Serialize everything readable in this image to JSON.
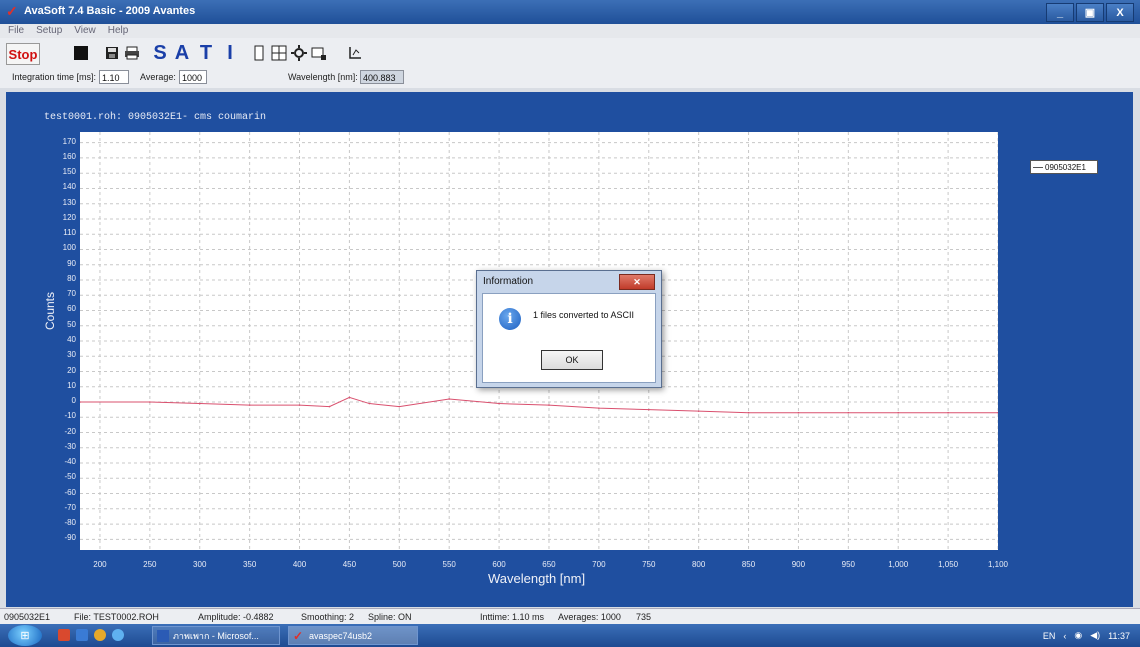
{
  "window": {
    "title": "AvaSoft 7.4 Basic - 2009 Avantes",
    "controls": [
      "_",
      "▣",
      "X"
    ]
  },
  "menu": [
    "File",
    "Setup",
    "View",
    "Help"
  ],
  "toolbar": {
    "stop_label": "Stop",
    "letters": [
      "S",
      "A",
      "T",
      "I"
    ]
  },
  "params": {
    "integration_label": "Integration time [ms]:",
    "integration_value": "1.10",
    "average_label": "Average:",
    "average_value": "1000",
    "wavelength_label": "Wavelength [nm]:",
    "wavelength_value": "400.883"
  },
  "chart_data": {
    "type": "line",
    "title": "test0001.roh: 0905032E1- cms coumarin",
    "xlabel": "Wavelength [nm]",
    "ylabel": "Counts",
    "xlim": [
      180,
      1100
    ],
    "ylim": [
      -97,
      177
    ],
    "x_ticks": [
      "200",
      "250",
      "300",
      "350",
      "400",
      "450",
      "500",
      "550",
      "600",
      "650",
      "700",
      "750",
      "800",
      "850",
      "900",
      "950",
      "1,000",
      "1,050",
      "1,100"
    ],
    "x_tick_values": [
      200,
      250,
      300,
      350,
      400,
      450,
      500,
      550,
      600,
      650,
      700,
      750,
      800,
      850,
      900,
      950,
      1000,
      1050,
      1100
    ],
    "y_ticks": [
      170,
      160,
      150,
      140,
      130,
      120,
      110,
      100,
      90,
      80,
      70,
      60,
      50,
      40,
      30,
      20,
      10,
      0,
      -10,
      -20,
      -30,
      -40,
      -50,
      -60,
      -70,
      -80,
      -90
    ],
    "grid": true,
    "legend": "right",
    "series": [
      {
        "name": "0905032E1",
        "color": "#d9506e",
        "x": [
          180,
          250,
          300,
          350,
          400,
          430,
          450,
          470,
          500,
          550,
          600,
          650,
          700,
          750,
          800,
          850,
          900,
          950,
          1000,
          1050,
          1100
        ],
        "y": [
          0,
          0,
          -1,
          -2,
          -2,
          -3,
          3,
          -1,
          -3,
          2,
          -1,
          -2,
          -4,
          -5,
          -6,
          -7,
          -7,
          -7,
          -7,
          -7,
          -7
        ]
      }
    ]
  },
  "dialog": {
    "title": "Information",
    "message": "1 files converted to ASCII",
    "ok_label": "OK"
  },
  "status": {
    "spectrum": "0905032E1",
    "file": "File: TEST0002.ROH",
    "amplitude": "Amplitude: -0.4882",
    "smoothing": "Smoothing: 2",
    "spline": "Spline: ON",
    "inttime": "Inttime: 1.10 ms",
    "averages": "Averages: 1000",
    "count": "735"
  },
  "taskbar": {
    "tasks": [
      "ภาพเพาก - Microsof...",
      "avaspec74usb2"
    ],
    "lang": "EN",
    "time": "11:37"
  }
}
